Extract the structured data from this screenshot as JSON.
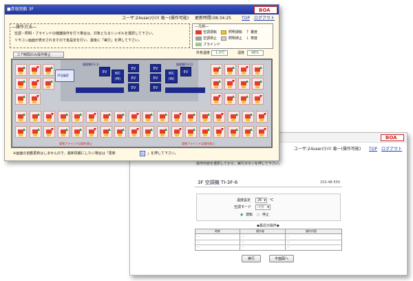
{
  "window1": {
    "title": "■赤坂別館 3F",
    "user_label": "ユーザ:24user/小川 竜一(操作可能)",
    "updated_label": "更新時間:08:34:25",
    "logo": "BOA",
    "nav_top": "TOP",
    "nav_logout": "ログアウト",
    "instructions_title": "―操作方法―",
    "instructions_line1": "空調・照明・ブラインドの機器操作を行う場合は、対象となるシンボルを選択して下さい。",
    "instructions_line2": "リモコン画面が表示されますので各設定を行い、最後に「実行」を押して下さい。",
    "legend_title": "―凡例―",
    "legend_ac_on": "空調運転",
    "legend_ac_off": "空調停止",
    "legend_light_on": "照明運転",
    "legend_light_off": "照明停止",
    "legend_blind": "ブラインド",
    "legend_hot": "暑度",
    "legend_cool": "寒度",
    "weather_label": "外気温度",
    "weather_value": "1.0℃",
    "humidity_label": "湿度",
    "humidity_value": "48%",
    "batch_button": "コア時間のみ操作禁止",
    "meeting_room": "3F会議室",
    "hall_label_left": "調理場(F3-1)",
    "hall_label_right": "調理場(F3-2)",
    "ev_label": "EV",
    "wc_m": "WC\n(M)",
    "wc_w": "WC\n(W)",
    "warning_left": "東側ブラインドは操作禁止",
    "warning_right": "東側ブラインドは操作禁止",
    "footer_note": "※画面の自動更新はしませんので、最新情報にしたい場合は「更新",
    "footer_note2": "」を押して下さい。"
  },
  "window2": {
    "user_label": "ユーザ:24user/小川 竜一(操作可能)",
    "logo": "BOA",
    "nav_top": "TOP",
    "nav_logout": "ログアウト",
    "hint": "操作内容を選択してから、実行ボタンを押して下さい。",
    "device_title": "3F 空調機 TI-3F-6",
    "device_code": "153-48-550",
    "temp_label": "温度設定",
    "temp_value": "26",
    "temp_unit": "℃",
    "mode_label": "空調モード",
    "mode_value": "冷房",
    "radio_on": "運転",
    "radio_off": "停止",
    "history_title": "◆最近の操作◆",
    "history_headers": [
      "時刻",
      "操作者",
      "操作内容"
    ],
    "history_rows": [
      [
        "----",
        "----",
        "----"
      ],
      [
        "----",
        "----",
        "----"
      ],
      [
        "----",
        "----",
        "----"
      ]
    ],
    "execute_button": "実行",
    "back_button": "平面図へ"
  }
}
